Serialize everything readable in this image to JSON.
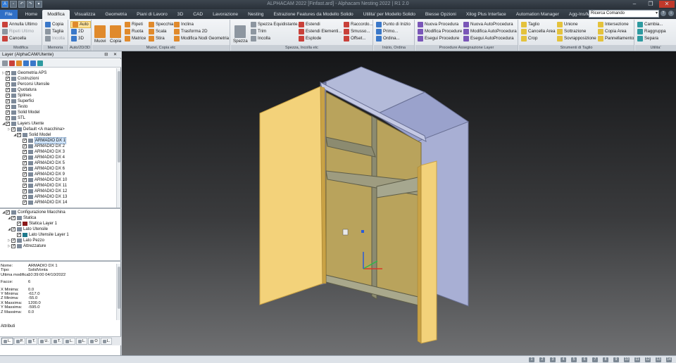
{
  "titlebar": {
    "title": "ALPHACAM 2022 [Finfast.ard] - Alphacam Nesting 2022 | R1 2.0",
    "quick_access": [
      "A",
      "▫",
      "↶",
      "↷",
      "▾"
    ],
    "window_controls": [
      "–",
      "❐",
      "✕"
    ]
  },
  "tabs": {
    "items": [
      "File",
      "Home",
      "Modifica",
      "Visualizza",
      "Geometria",
      "Piani di Lavoro",
      "3D",
      "CAD",
      "Lavorazione",
      "Nesting",
      "Estrazione Features da Modello Solido",
      "Utilita' per Modello Solido",
      "Biesse Opzioni",
      "Xilog Plus Interface",
      "Automation Manager",
      "Agg-Ins/Macro"
    ],
    "active_index": 2,
    "search_value": "Ricerca Comando",
    "right_icons": [
      "?",
      "i"
    ]
  },
  "ribbon": {
    "groups": [
      {
        "label": "Modifica",
        "buttons": [
          "Annulla Ultimo",
          "Ripeti Ultimo",
          "Cancella"
        ]
      },
      {
        "label": "Memoria",
        "buttons": [
          "Copia",
          "Taglia",
          "Incolla"
        ]
      },
      {
        "label": "Auto/2D/3D",
        "buttons": [
          "Auto",
          "2D",
          "3D"
        ]
      },
      {
        "label": "Muovi, Copia etc",
        "buttons": [
          "Muovi",
          "Copia",
          "Ripeti",
          "Ruota",
          "Matrice",
          "Specchia",
          "Scala",
          "Stira",
          "Inclina",
          "Trasforma 2D",
          "Modifica Nodi Geometria"
        ]
      },
      {
        "label": "Spezza, Incolla etc",
        "buttons": [
          "Spezza",
          "Spezza Equidistante...",
          "Trim",
          "Incolla",
          "Estendi",
          "Estendi Elementi...",
          "Esplode",
          "Raccordo...",
          "Smusso...",
          "Offset..."
        ]
      },
      {
        "label": "Inizio, Ordina",
        "buttons": [
          "Punto di Inizio",
          "Primo...",
          "Ordina..."
        ]
      },
      {
        "label": "Procedure Assegnazione Layer",
        "buttons": [
          "Nuova Procedura",
          "Modifica Procedure",
          "Esegui Procedure",
          "Nuova AutoProcedura",
          "Modifica AutoProcedura",
          "Esegui AutoProcedura"
        ]
      },
      {
        "label": "Strumenti di Taglio",
        "buttons": [
          "Taglio",
          "Cancella Area",
          "Crop",
          "Unione",
          "Sottrazione",
          "Sovrapposizione",
          "Intersezione",
          "Copia Area",
          "Pannellamento"
        ]
      },
      {
        "label": "Utilita'",
        "buttons": [
          "Cambia...",
          "Raggruppa",
          "Separa"
        ]
      }
    ]
  },
  "panel": {
    "title": "Layer (AlphaCAM/Utente)",
    "title_buttons": "⊟ ✕",
    "tree": [
      {
        "label": "Geometria APS",
        "level": 0,
        "exp": "▷"
      },
      {
        "label": "Costruzioni",
        "level": 0,
        "exp": ""
      },
      {
        "label": "Percorsi Utensile",
        "level": 0,
        "exp": ""
      },
      {
        "label": "Quotatura",
        "level": 0,
        "exp": ""
      },
      {
        "label": "Splines",
        "level": 0,
        "exp": ""
      },
      {
        "label": "Superfici",
        "level": 0,
        "exp": ""
      },
      {
        "label": "Testo",
        "level": 0,
        "exp": ""
      },
      {
        "label": "Solid Model",
        "level": 0,
        "exp": ""
      },
      {
        "label": "STL",
        "level": 0,
        "exp": ""
      },
      {
        "label": "Layers Utente",
        "level": 0,
        "exp": "◢"
      },
      {
        "label": "Default <A macchina>",
        "level": 1,
        "exp": "▷"
      },
      {
        "label": "Solid Model",
        "level": 2,
        "exp": "◢"
      },
      {
        "label": "ARMADIO DX 1",
        "level": 3,
        "exp": "",
        "sel": true
      },
      {
        "label": "ARMADIO DX 2",
        "level": 3,
        "exp": ""
      },
      {
        "label": "ARMADIO DX 3",
        "level": 3,
        "exp": ""
      },
      {
        "label": "ARMADIO DX 4",
        "level": 3,
        "exp": ""
      },
      {
        "label": "ARMADIO DX 5",
        "level": 3,
        "exp": ""
      },
      {
        "label": "ARMADIO DX 6",
        "level": 3,
        "exp": ""
      },
      {
        "label": "ARMADIO DX 9",
        "level": 3,
        "exp": ""
      },
      {
        "label": "ARMADIO DX 10",
        "level": 3,
        "exp": ""
      },
      {
        "label": "ARMADIO DX 11",
        "level": 3,
        "exp": ""
      },
      {
        "label": "ARMADIO DX 12",
        "level": 3,
        "exp": ""
      },
      {
        "label": "ARMADIO DX 13",
        "level": 3,
        "exp": ""
      },
      {
        "label": "ARMADIO DX 14",
        "level": 3,
        "exp": ""
      }
    ],
    "tree2": [
      {
        "label": "Configurazione Macchina",
        "level": 0,
        "exp": "◢"
      },
      {
        "label": "Statica",
        "level": 1,
        "exp": "◢"
      },
      {
        "label": "Statica Layer 1",
        "level": 2,
        "exp": "",
        "swatch": "#8b1a1a"
      },
      {
        "label": "Lato Utensile",
        "level": 1,
        "exp": "◢"
      },
      {
        "label": "Lato Utensile Layer 1",
        "level": 2,
        "exp": "",
        "swatch": "#1f7a8c"
      },
      {
        "label": "Lato Pezzo",
        "level": 1,
        "exp": "▷"
      },
      {
        "label": "Attrezzature",
        "level": 1,
        "exp": "▷"
      }
    ],
    "properties": [
      {
        "k": "Nome:",
        "v": "ARMADIO DX 1"
      },
      {
        "k": "Tipo:",
        "v": "SolidVonta"
      },
      {
        "k": "Ultima modifica:",
        "v": "10:39:00 04/10/2022"
      },
      {
        "k": "",
        "v": ""
      },
      {
        "k": "Facce:",
        "v": "6"
      },
      {
        "k": "",
        "v": ""
      },
      {
        "k": "X Minima:",
        "v": "0.0"
      },
      {
        "k": "Y Minima:",
        "v": "-617.0"
      },
      {
        "k": "Z Minima:",
        "v": "-55.0"
      },
      {
        "k": "X Massima:",
        "v": "1200.0"
      },
      {
        "k": "Y Massima:",
        "v": "-595.0"
      },
      {
        "k": "Z Massima:",
        "v": "0.0"
      }
    ],
    "attributes_label": "Attributi",
    "bottom_tabs": [
      "L.",
      "P.",
      "T.",
      "U.",
      "T.",
      "L.",
      "L.",
      "O",
      "L."
    ]
  },
  "status": {
    "icons": [
      "1",
      "2",
      "3",
      "4",
      "5",
      "6",
      "7",
      "8",
      "9",
      "10",
      "11",
      "12",
      "13",
      "14"
    ]
  },
  "colors": {
    "door": "#f3d27a",
    "door_edge": "#c9a245",
    "interior": "#b9a35c",
    "shelf": "#8c8b70",
    "carcass": "#a8afd4",
    "carcass_dark": "#8087b0",
    "highlight": "#ffe39a"
  }
}
